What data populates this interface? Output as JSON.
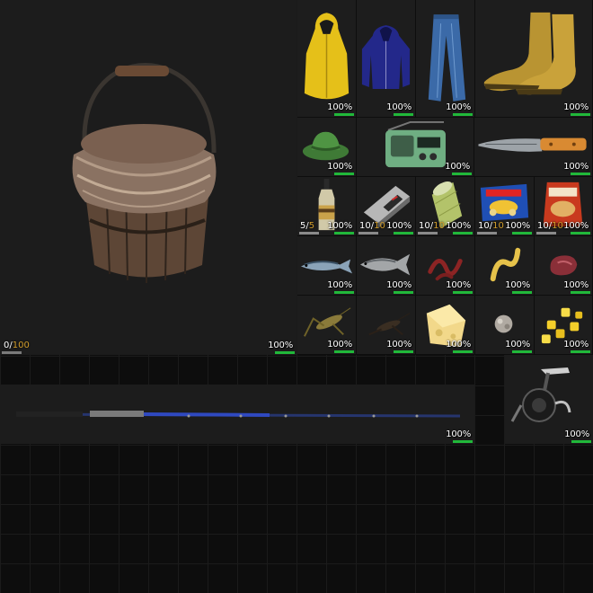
{
  "container": {
    "name": "Bucket",
    "capacity_current": "0",
    "capacity_sep": "/",
    "capacity_max": "100",
    "condition": "100%"
  },
  "items": {
    "raincoat": {
      "condition": "100%"
    },
    "hoodie": {
      "condition": "100%"
    },
    "jeans": {
      "condition": "100%"
    },
    "boots": {
      "condition": "100%"
    },
    "bucket_hat": {
      "condition": "100%"
    },
    "radio": {
      "condition": "100%"
    },
    "knife": {
      "condition": "100%"
    },
    "bottle": {
      "condition": "100%",
      "qty_current": "5",
      "qty_sep": "/",
      "qty_max": "5"
    },
    "phone_box": {
      "condition": "100%",
      "qty_current": "10",
      "qty_sep": "/",
      "qty_max": "10"
    },
    "fishing_line": {
      "condition": "100%",
      "qty_current": "10",
      "qty_sep": "/",
      "qty_max": "10"
    },
    "cracker_box": {
      "condition": "100%",
      "qty_current": "10",
      "qty_sep": "/",
      "qty_max": "10"
    },
    "chips_bag": {
      "condition": "100%",
      "qty_current": "10",
      "qty_sep": "/",
      "qty_max": "10"
    },
    "mackerel": {
      "condition": "100%"
    },
    "fish_silver": {
      "condition": "100%"
    },
    "worm_red": {
      "condition": "100%"
    },
    "worm_yellow": {
      "condition": "100%"
    },
    "meat_bait": {
      "condition": "100%"
    },
    "grasshopper": {
      "condition": "100%"
    },
    "cricket": {
      "condition": "100%"
    },
    "cheese": {
      "condition": "100%"
    },
    "dough_ball": {
      "condition": "100%"
    },
    "corn": {
      "condition": "100%"
    },
    "fishing_rod": {
      "condition": "100%"
    },
    "reel": {
      "condition": "100%"
    }
  },
  "colors": {
    "condition_bar": "#21b83a",
    "quantity_max": "#d19d2c"
  },
  "icons": [
    "bucket-icon",
    "raincoat-icon",
    "hoodie-icon",
    "jeans-icon",
    "boots-icon",
    "bucket-hat-icon",
    "radio-icon",
    "knife-icon",
    "bottle-icon",
    "phone-box-icon",
    "fishing-line-icon",
    "cracker-box-icon",
    "chips-bag-icon",
    "mackerel-icon",
    "fish-icon",
    "red-worm-icon",
    "yellow-worm-icon",
    "meat-bait-icon",
    "grasshopper-icon",
    "cricket-icon",
    "cheese-icon",
    "dough-ball-icon",
    "corn-icon",
    "fishing-rod-icon",
    "reel-icon"
  ]
}
